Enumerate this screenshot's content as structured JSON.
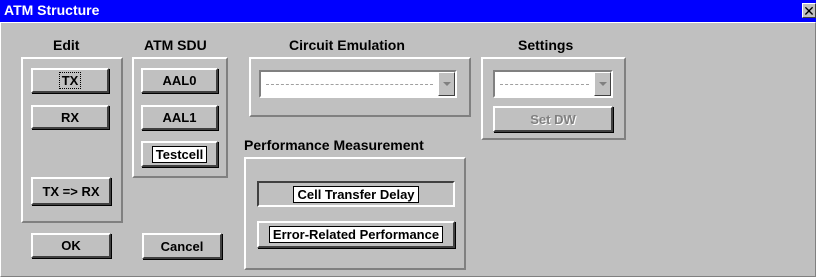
{
  "window": {
    "title": "ATM Structure",
    "close_glyph": "✕"
  },
  "edit": {
    "heading": "Edit",
    "tx_label": "TX",
    "rx_label": "RX",
    "tx_to_rx_label": "TX => RX"
  },
  "atm_sdu": {
    "heading": "ATM SDU",
    "aal0_label": "AAL0",
    "aal1_label": "AAL1",
    "testcell_label": "Testcell"
  },
  "circuit_emulation": {
    "heading": "Circuit Emulation",
    "selected_value": ""
  },
  "settings": {
    "heading": "Settings",
    "selected_value": "",
    "set_dw_label": "Set DW"
  },
  "performance": {
    "heading": "Performance Measurement",
    "cell_transfer_delay_label": "Cell Transfer Delay",
    "error_related_label": "Error-Related Performance"
  },
  "footer": {
    "ok_label": "OK",
    "cancel_label": "Cancel"
  },
  "icons": {
    "close": "close-icon",
    "dropdown": "chevron-down-icon"
  },
  "colors": {
    "titlebar": "#0000ff",
    "face": "#c0c0c0"
  }
}
